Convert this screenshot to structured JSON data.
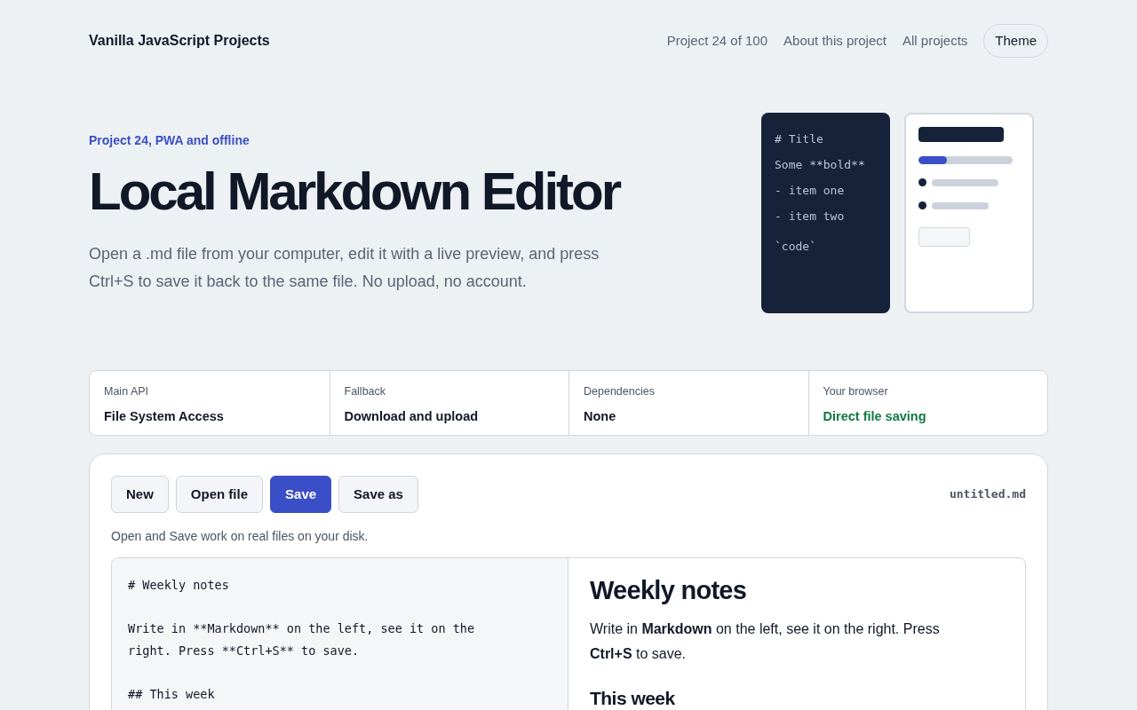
{
  "header": {
    "brand": "Vanilla JavaScript Projects",
    "links": [
      "Project 24 of 100",
      "About this project",
      "All projects"
    ],
    "theme_button": "Theme"
  },
  "hero": {
    "eyebrow": "Project 24, PWA and offline",
    "title": "Local Markdown Editor",
    "description": "Open a .md file from your computer, edit it with a live preview, and press Ctrl+S to save it back to the same file. No upload, no account.",
    "code_sample": [
      "# Title",
      "Some **bold**",
      "- item one",
      "- item two",
      "`code`"
    ]
  },
  "facts": [
    {
      "label": "Main API",
      "value": "File System Access",
      "kind": "plain"
    },
    {
      "label": "Fallback",
      "value": "Download and upload",
      "kind": "plain"
    },
    {
      "label": "Dependencies",
      "value": "None",
      "kind": "plain"
    },
    {
      "label": "Your browser",
      "value": "Direct file saving",
      "kind": "ok"
    }
  ],
  "toolbar": {
    "buttons": [
      {
        "label": "New",
        "kind": "default"
      },
      {
        "label": "Open file",
        "kind": "default"
      },
      {
        "label": "Save",
        "kind": "primary"
      },
      {
        "label": "Save as",
        "kind": "default"
      }
    ],
    "filename": "untitled.md",
    "note": "Open and Save work on real files on your disk."
  },
  "editor": {
    "source": "# Weekly notes\n\nWrite in **Markdown** on the left, see it on the right. Press **Ctrl+S** to save.\n\n## This week"
  },
  "preview": [
    {
      "kind": "h1",
      "text": "Weekly notes"
    },
    {
      "kind": "p",
      "text": "Write in **Markdown** on the left, see it on the right. Press **Ctrl+S** to save."
    },
    {
      "kind": "h2",
      "text": "This week"
    }
  ]
}
